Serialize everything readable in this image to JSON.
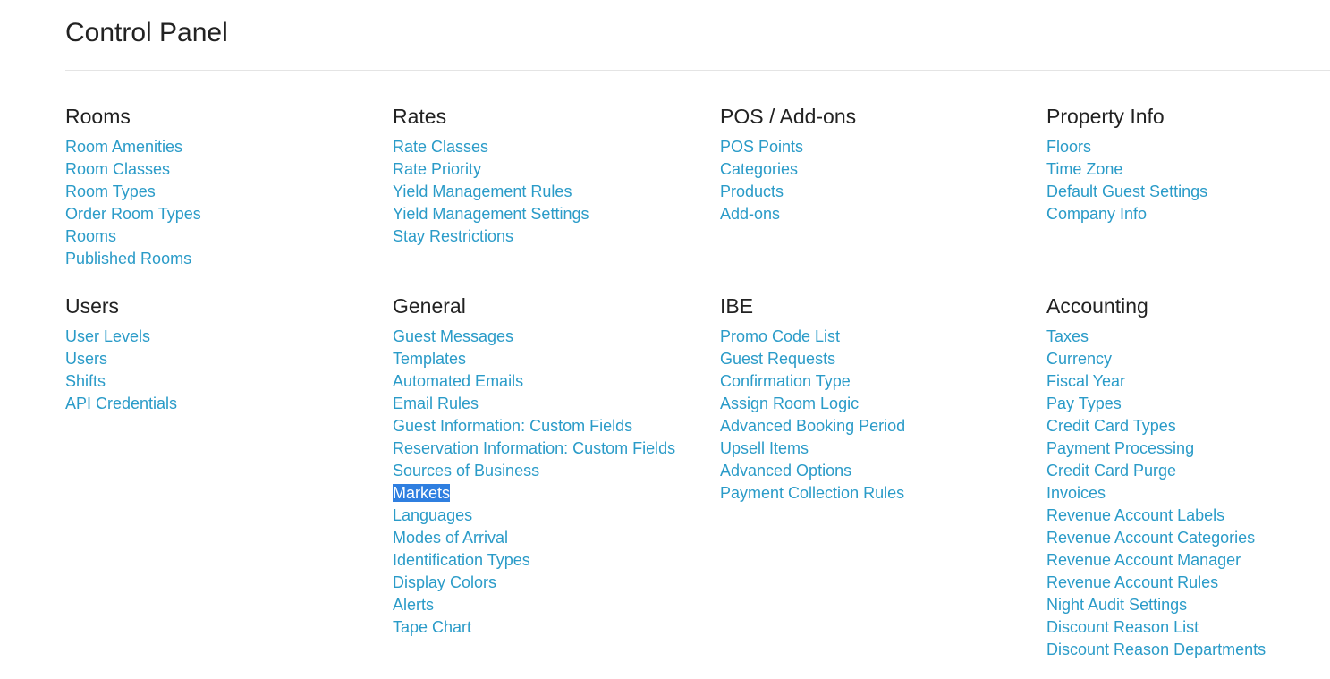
{
  "page": {
    "title": "Control Panel"
  },
  "sections": {
    "rooms": {
      "title": "Rooms",
      "items": [
        "Room Amenities",
        "Room Classes",
        "Room Types",
        "Order Room Types",
        "Rooms",
        "Published Rooms"
      ]
    },
    "rates": {
      "title": "Rates",
      "items": [
        "Rate Classes",
        "Rate Priority",
        "Yield Management Rules",
        "Yield Management Settings",
        "Stay Restrictions"
      ]
    },
    "pos": {
      "title": "POS / Add-ons",
      "items": [
        "POS Points",
        "Categories",
        "Products",
        "Add-ons"
      ]
    },
    "property": {
      "title": "Property Info",
      "items": [
        "Floors",
        "Time Zone",
        "Default Guest Settings",
        "Company Info"
      ]
    },
    "users": {
      "title": "Users",
      "items": [
        "User Levels",
        "Users",
        "Shifts",
        "API Credentials"
      ]
    },
    "general": {
      "title": "General",
      "items": [
        "Guest Messages",
        "Templates",
        "Automated Emails",
        "Email Rules",
        "Guest Information: Custom Fields",
        "Reservation Information: Custom Fields",
        "Sources of Business",
        "Markets",
        "Languages",
        "Modes of Arrival",
        "Identification Types",
        "Display Colors",
        "Alerts",
        "Tape Chart"
      ],
      "selected": "Markets"
    },
    "ibe": {
      "title": "IBE",
      "items": [
        "Promo Code List",
        "Guest Requests",
        "Confirmation Type",
        "Assign Room Logic",
        "Advanced Booking Period",
        "Upsell Items",
        "Advanced Options",
        "Payment Collection Rules"
      ]
    },
    "accounting": {
      "title": "Accounting",
      "items": [
        "Taxes",
        "Currency",
        "Fiscal Year",
        "Pay Types",
        "Credit Card Types",
        "Payment Processing",
        "Credit Card Purge",
        "Invoices",
        "Revenue Account Labels",
        "Revenue Account Categories",
        "Revenue Account Manager",
        "Revenue Account Rules",
        "Night Audit Settings",
        "Discount Reason List",
        "Discount Reason Departments"
      ]
    }
  },
  "colors": {
    "link": "#2a9bc8",
    "heading": "#222222",
    "selection": "#2f7fe0"
  }
}
